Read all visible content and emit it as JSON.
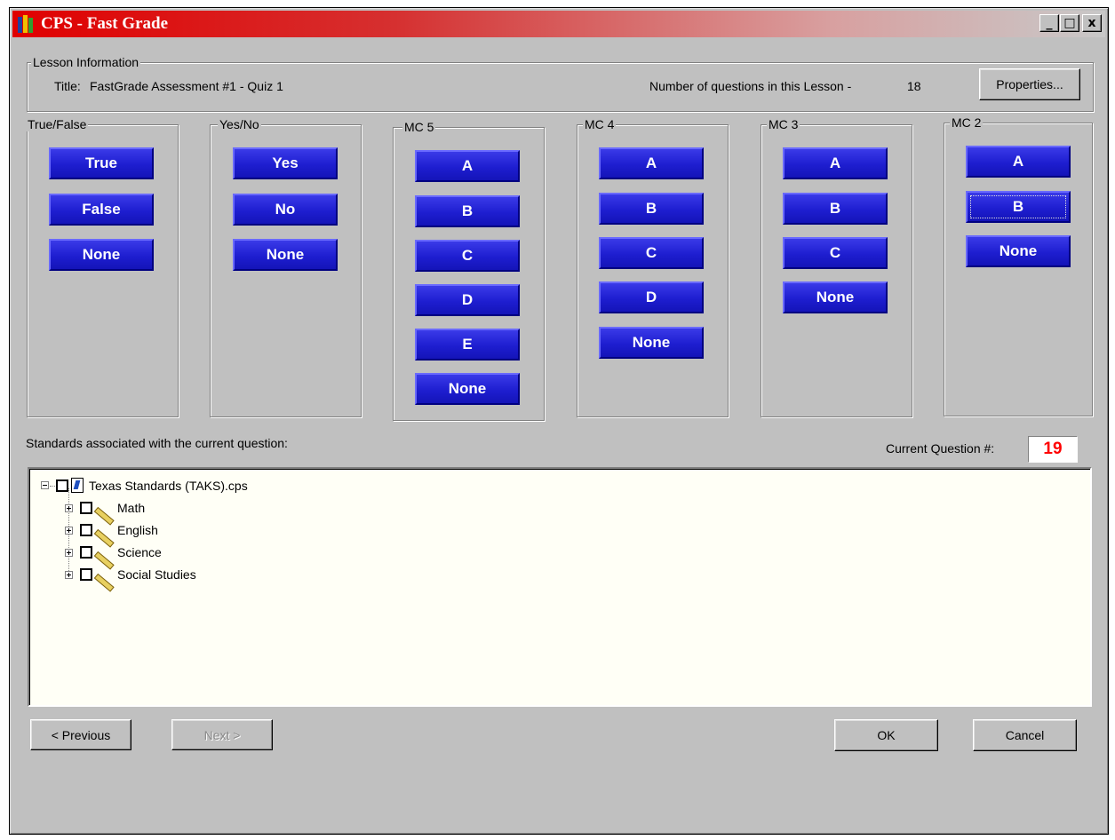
{
  "window": {
    "title": "CPS - Fast Grade",
    "controls": {
      "minimize": "_",
      "maximize": "□",
      "close": "x"
    }
  },
  "lesson": {
    "group_label": "Lesson Information",
    "title_label": "Title:",
    "title_value": "FastGrade Assessment #1 - Quiz 1",
    "count_label": "Number of questions in this Lesson -",
    "count_value": "18",
    "properties_button": "Properties..."
  },
  "groups": [
    {
      "label": "True/False",
      "buttons": [
        "True",
        "False",
        "None"
      ]
    },
    {
      "label": "Yes/No",
      "buttons": [
        "Yes",
        "No",
        "None"
      ]
    },
    {
      "label": "MC 5",
      "buttons": [
        "A",
        "B",
        "C",
        "D",
        "E",
        "None"
      ]
    },
    {
      "label": "MC 4",
      "buttons": [
        "A",
        "B",
        "C",
        "D",
        "None"
      ]
    },
    {
      "label": "MC 3",
      "buttons": [
        "A",
        "B",
        "C",
        "None"
      ]
    },
    {
      "label": "MC 2",
      "buttons": [
        "A",
        "B",
        "None"
      ]
    }
  ],
  "standards": {
    "label": "Standards associated with the current question:",
    "current_question_label": "Current Question #:",
    "current_question_value": "19",
    "tree": {
      "root": "Texas Standards (TAKS).cps",
      "children": [
        "Math",
        "English",
        "Science",
        "Social Studies"
      ]
    }
  },
  "footer": {
    "previous": "< Previous",
    "next": "Next >",
    "ok": "OK",
    "cancel": "Cancel"
  },
  "colors": {
    "accent_blue": "#1e1ed0",
    "question_red": "#ff0000",
    "title_red": "#e00000"
  }
}
